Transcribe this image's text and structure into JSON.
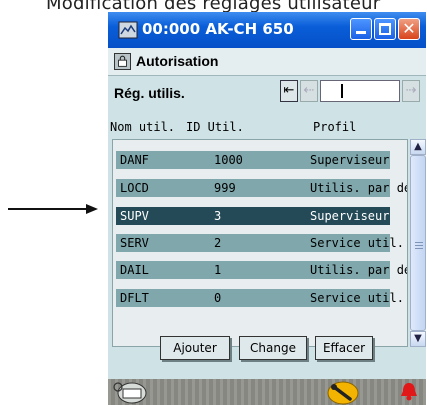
{
  "caption": "Modification des réglages utilisateur",
  "window": {
    "title": "00:000 AK-CH 650",
    "close_glyph": "✕"
  },
  "menu": {
    "label": "Autorisation",
    "icon": "padlock-icon"
  },
  "screen": {
    "title": "Rég. utilis."
  },
  "pager": {
    "first": "⇤",
    "prev": "⇠",
    "next": "⇢"
  },
  "table": {
    "columns": [
      "Nom util.",
      "ID Util.",
      "Profil"
    ],
    "rows": [
      {
        "name": "DANF",
        "id": "1000",
        "profile": "Superviseur",
        "selected": false
      },
      {
        "name": "LOCD",
        "id": "999",
        "profile": "Utilis. par défaut",
        "selected": false
      },
      {
        "name": "SUPV",
        "id": "3",
        "profile": "Superviseur",
        "selected": true
      },
      {
        "name": "SERV",
        "id": "2",
        "profile": "Service util.",
        "selected": false
      },
      {
        "name": "DAIL",
        "id": "1",
        "profile": "Utilis. par défaut",
        "selected": false
      },
      {
        "name": "DFLT",
        "id": "0",
        "profile": "Service util.",
        "selected": false
      }
    ]
  },
  "buttons": {
    "add": "Ajouter",
    "change": "Change",
    "delete": "Effacer"
  },
  "statusbar": {
    "left_icon": "keyboard-icon",
    "key_icon": "wrench-icon",
    "alarm_icon": "bell-icon",
    "alarm_color": "#e01818"
  },
  "colors": {
    "titlebar": "#0a5ed8",
    "row": "#7fa7ac",
    "row_selected": "#244a58",
    "background": "#cfe3e6"
  }
}
